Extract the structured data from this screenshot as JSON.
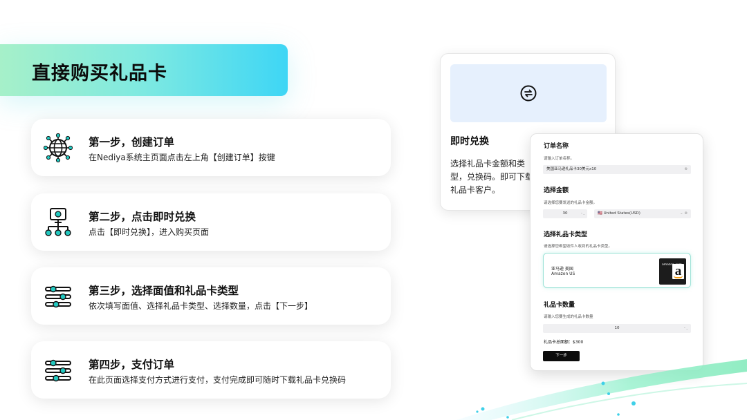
{
  "header": {
    "title": "直接购买礼品卡"
  },
  "steps": [
    {
      "title": "第一步，创建订单",
      "desc": "在Nediya系统主页面点击左上角【创建订单】按键",
      "icon": "globe-network-icon"
    },
    {
      "title": "第二步，点击即时兑换",
      "desc": "点击【即时兑换】，进入购买页面",
      "icon": "computer-network-icon"
    },
    {
      "title": "第三步，选择面值和礼品卡类型",
      "desc": "依次填写面值、选择礼品卡类型、选择数量，点击【下一步】",
      "icon": "sliders-icon"
    },
    {
      "title": "第四步，支付订单",
      "desc": "在此页面选择支付方式进行支付，支付完成即可随时下载礼品卡兑换码",
      "icon": "sliders-icon"
    }
  ],
  "exchange_card": {
    "title": "即时兑换",
    "desc": "选择礼品卡金额和类型，兑换码。即可下载礼品卡客户。",
    "icon": "exchange-arrows-icon"
  },
  "order_form": {
    "order_name": {
      "label": "订单名称",
      "hint": "请输入订单名称。",
      "value": "美国亚马逊礼品卡30美元x10"
    },
    "amount": {
      "label": "选择金额",
      "hint": "请选择您要发送的礼品卡金额。",
      "value": "30",
      "currency": "🇺🇸 United States(USD)"
    },
    "card_type": {
      "label": "选择礼品卡类型",
      "hint": "请选择您希望收件人收到的礼品卡类型。",
      "name_cn": "亚马逊 美国",
      "name_en": "Amazon US",
      "logo_text": "amazon.com"
    },
    "quantity": {
      "label": "礼品卡数量",
      "hint": "请输入您要生成的礼品卡数量",
      "value": "10"
    },
    "total": "礼品卡总面额：$300",
    "next_label": "下一步"
  },
  "colors": {
    "accent_start": "#a6f0c9",
    "accent_end": "#3ed6f5",
    "teal": "#22c8c0"
  }
}
